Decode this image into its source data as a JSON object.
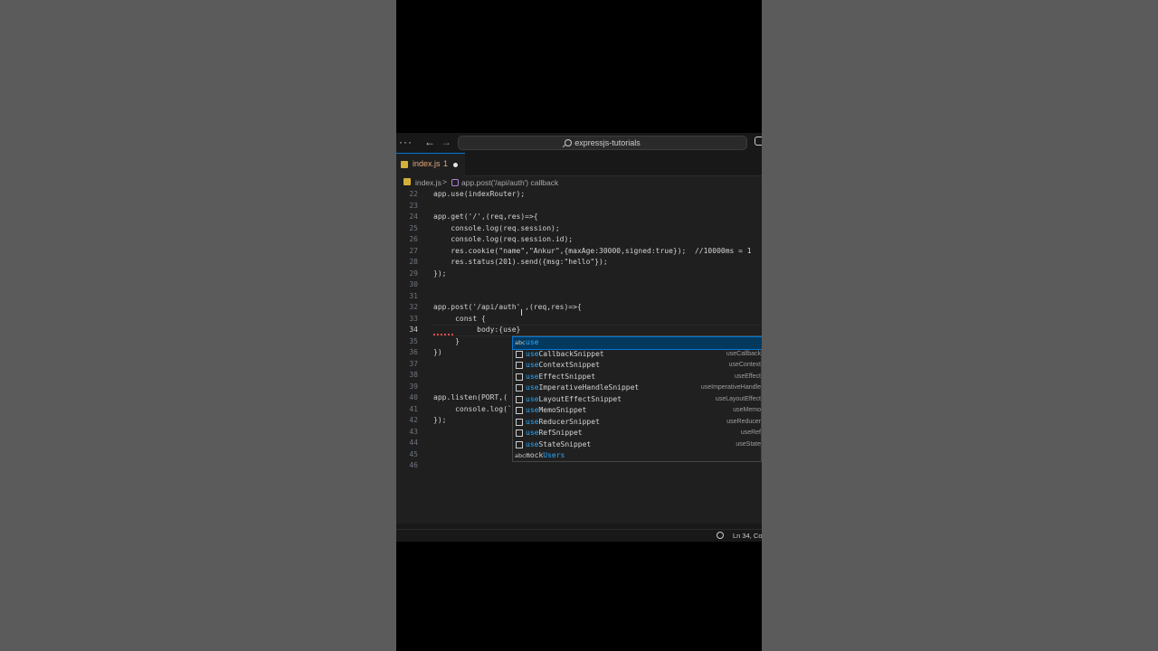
{
  "titlebar": {
    "menu_label": "···",
    "back_label": "←",
    "forward_label": "→",
    "search_text": "expressjs-tutorials"
  },
  "tab": {
    "label": "index.js",
    "problem_count": "1"
  },
  "breadcrumb": {
    "file": "index.js",
    "separator": ">",
    "symbol": "app.post('/api/auth') callback"
  },
  "lines": [
    {
      "n": "22",
      "text": "app.use(indexRouter);"
    },
    {
      "n": "23",
      "text": ""
    },
    {
      "n": "24",
      "text": "app.get('/',(req,res)=>{"
    },
    {
      "n": "25",
      "text": "    console.log(req.session);"
    },
    {
      "n": "26",
      "text": "    console.log(req.session.id);"
    },
    {
      "n": "27",
      "text": "    res.cookie(\"name\",\"Ankur\",{maxAge:30000,signed:true});  //10000ms = 1"
    },
    {
      "n": "28",
      "text": "    res.status(201).send({msg:\"hello\"});"
    },
    {
      "n": "29",
      "text": "});"
    },
    {
      "n": "30",
      "text": ""
    },
    {
      "n": "31",
      "text": ""
    },
    {
      "n": "32",
      "text": "app.post('/api/auth' ,(req,res)=>{"
    },
    {
      "n": "33",
      "text": "     const {"
    },
    {
      "n": "34",
      "text": "          body:{use}"
    },
    {
      "n": "35",
      "text": "     }"
    },
    {
      "n": "36",
      "text": "})"
    },
    {
      "n": "37",
      "text": ""
    },
    {
      "n": "38",
      "text": ""
    },
    {
      "n": "39",
      "text": ""
    },
    {
      "n": "40",
      "text": "app.listen(PORT,("
    },
    {
      "n": "41",
      "text": "     console.log(`"
    },
    {
      "n": "42",
      "text": "});"
    },
    {
      "n": "43",
      "text": ""
    },
    {
      "n": "44",
      "text": ""
    },
    {
      "n": "45",
      "text": ""
    },
    {
      "n": "46",
      "text": ""
    }
  ],
  "suggestions": [
    {
      "match": "use",
      "rest": "",
      "detail": "",
      "icon": "abc-icon"
    },
    {
      "match": "use",
      "rest": "CallbackSnippet",
      "detail": "useCallback",
      "icon": "snippet-icon"
    },
    {
      "match": "use",
      "rest": "ContextSnippet",
      "detail": "useContext",
      "icon": "snippet-icon"
    },
    {
      "match": "use",
      "rest": "EffectSnippet",
      "detail": "useEffect",
      "icon": "snippet-icon"
    },
    {
      "match": "use",
      "rest": "ImperativeHandleSnippet",
      "detail": "useImperativeHandle",
      "icon": "snippet-icon"
    },
    {
      "match": "use",
      "rest": "LayoutEffectSnippet",
      "detail": "useLayoutEffect",
      "icon": "snippet-icon"
    },
    {
      "match": "use",
      "rest": "MemoSnippet",
      "detail": "useMemo",
      "icon": "snippet-icon"
    },
    {
      "match": "use",
      "rest": "ReducerSnippet",
      "detail": "useReducer",
      "icon": "snippet-icon"
    },
    {
      "match": "use",
      "rest": "RefSnippet",
      "detail": "useRef",
      "icon": "snippet-icon"
    },
    {
      "match": "use",
      "rest": "StateSnippet",
      "detail": "useState",
      "icon": "snippet-icon"
    },
    {
      "match": "mock",
      "rest": "Users",
      "detail": "",
      "icon": "abc-icon"
    }
  ],
  "statusbar": {
    "position": "Ln 34, Co"
  },
  "colors": {
    "accent": "#0078d4",
    "selection": "#04395e",
    "match_highlight": "#2aaaff",
    "modified_tab": "#e2a87a",
    "error": "#f14c4c"
  }
}
